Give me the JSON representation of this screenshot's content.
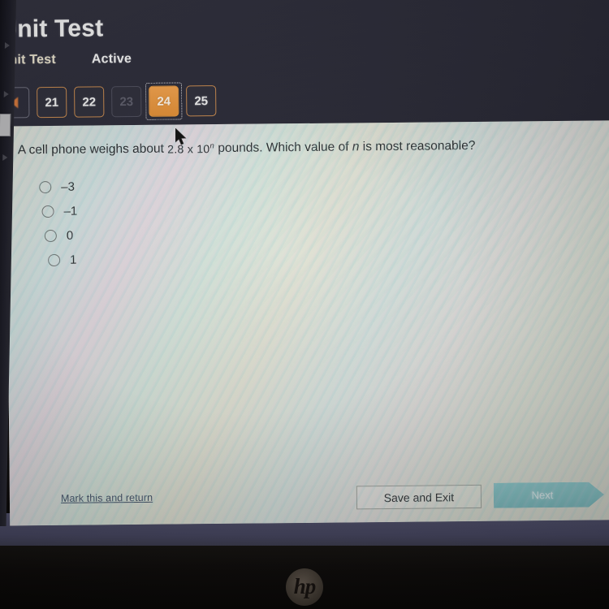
{
  "header": {
    "title": "Unit Test",
    "tabs": [
      {
        "label": "Unit Test",
        "style": "cream"
      },
      {
        "label": "Active",
        "style": "plain"
      }
    ]
  },
  "pager": {
    "back_icon": "left-triangle-icon",
    "questions": [
      {
        "number": "21",
        "state": "available"
      },
      {
        "number": "22",
        "state": "available"
      },
      {
        "number": "23",
        "state": "disabled"
      },
      {
        "number": "24",
        "state": "current"
      },
      {
        "number": "25",
        "state": "available"
      }
    ]
  },
  "question": {
    "text_before": "A cell phone weighs about",
    "scientific": "2.8 x 10",
    "exponent": "n",
    "text_mid": "pounds. Which value of",
    "variable": "n",
    "text_after": "is most reasonable?"
  },
  "options": [
    {
      "label": "–3",
      "selected": false
    },
    {
      "label": "–1",
      "selected": false
    },
    {
      "label": "0",
      "selected": false
    },
    {
      "label": "1",
      "selected": false
    }
  ],
  "footer": {
    "mark_link": "Mark this and return",
    "save_label": "Save and Exit",
    "next_label": "Next"
  },
  "device": {
    "brand_logo": "hp"
  },
  "colors": {
    "header_bg": "#2c2c39",
    "accent_orange": "#e8943c",
    "current_question_bg": "#eb9a41",
    "content_bg": "#dcdfd4",
    "next_button": "#78babf",
    "link": "#3e4f66",
    "tab_cream": "#e9e2cd",
    "desktop_band": "#41415a"
  }
}
